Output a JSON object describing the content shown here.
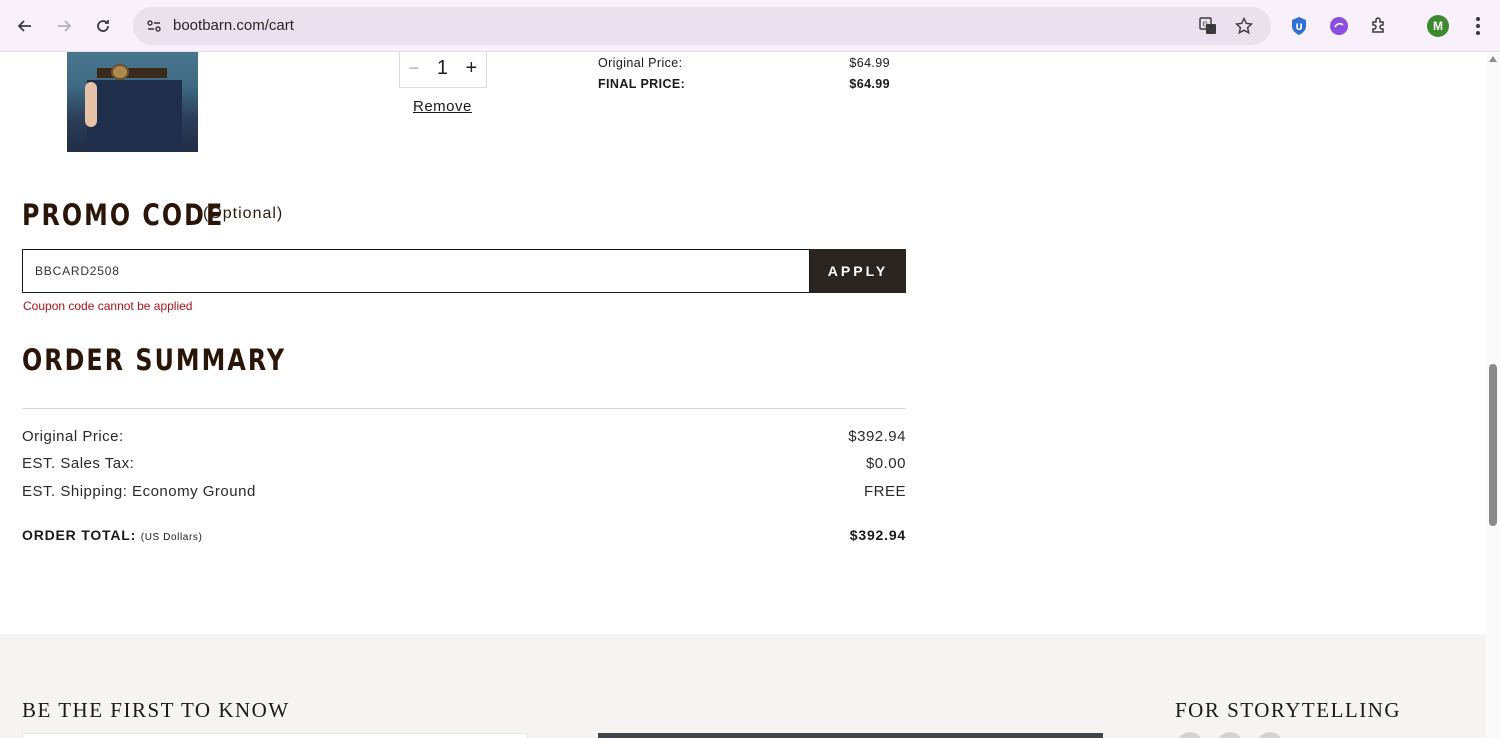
{
  "browser": {
    "url": "bootbarn.com/cart",
    "profile_initial": "M"
  },
  "cart_item": {
    "quantity": "1",
    "qty_minus": "−",
    "qty_plus": "+",
    "remove_label": "Remove",
    "original_price_label": "Original Price:",
    "original_price_value": "$64.99",
    "final_price_label": "FINAL PRICE:",
    "final_price_value": "$64.99"
  },
  "promo": {
    "title": "PROMO CODE",
    "optional": "(Optional)",
    "input_value": "BBCARD2508",
    "apply_label": "APPLY",
    "error": "Coupon code cannot be applied"
  },
  "summary": {
    "title": "ORDER SUMMARY",
    "rows": [
      {
        "label": "Original Price:",
        "value": "$392.94"
      },
      {
        "label": "EST. Sales Tax:",
        "value": "$0.00"
      },
      {
        "label": "EST. Shipping: Economy Ground",
        "value": "FREE"
      }
    ],
    "total_label": "ORDER TOTAL:",
    "total_note": "(US Dollars)",
    "total_value": "$392.94"
  },
  "footer": {
    "newsletter_heading": "BE THE FIRST TO KNOW",
    "social_heading": "FOR STORYTELLING"
  },
  "colors": {
    "heading": "#2b1508",
    "apply_button": "#2b2522",
    "error": "#b0121b",
    "footer_bg": "#f5f4f2"
  }
}
